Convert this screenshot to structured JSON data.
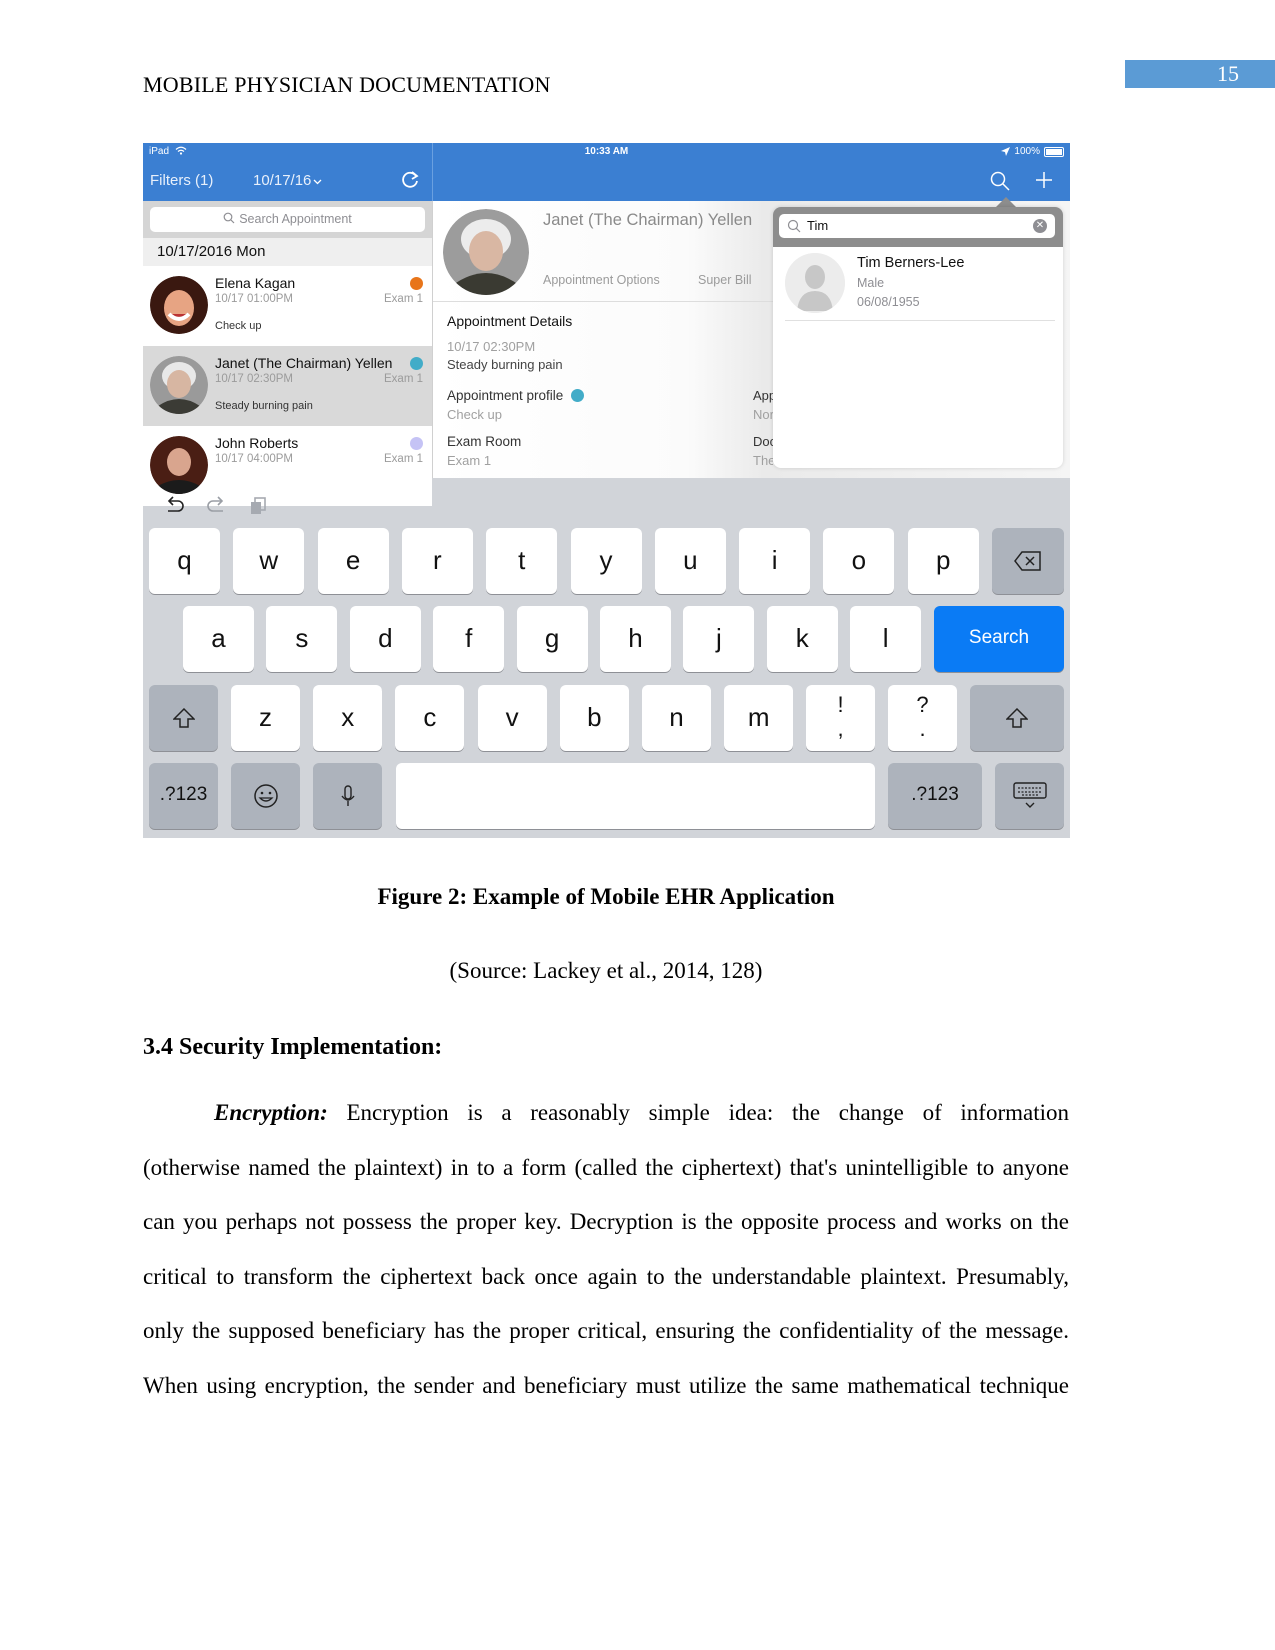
{
  "document": {
    "running_head": "MOBILE PHYSICIAN DOCUMENTATION",
    "page_number": "15",
    "figure_caption": "Figure 2: Example of Mobile EHR Application",
    "figure_source": "(Source: Lackey et al., 2014, 128)",
    "section_heading": "3.4 Security Implementation:",
    "paragraph": {
      "lead_term": "Encryption:",
      "lines": [
        "Encryption is a reasonably simple idea: the change of information",
        "(otherwise named the plaintext) in to a form (called the ciphertext) that's unintelligible to anyone",
        "can you perhaps not possess the proper key. Decryption is the opposite process and works on the",
        "critical to transform the ciphertext back once again to the understandable plaintext. Presumably,",
        "only the supposed beneficiary has the proper critical, ensuring the confidentiality of the message.",
        "When using encryption, the sender and beneficiary must utilize the same mathematical technique"
      ]
    }
  },
  "app": {
    "status_bar": {
      "device": "iPad",
      "time": "10:33 AM",
      "battery": "100%"
    },
    "nav": {
      "filters_label": "Filters (1)",
      "date_label": "10/17/16",
      "icons": [
        "wifi-icon",
        "refresh-icon",
        "search-icon",
        "plus-icon",
        "location-arrow-icon",
        "battery-icon"
      ]
    },
    "appointments": {
      "search_placeholder": "Search Appointment",
      "date_header": "10/17/2016 Mon",
      "items": [
        {
          "name": "Elena Kagan",
          "time": "10/17 01:00PM",
          "room": "Exam 1",
          "reason": "Check up",
          "status_color": "#e8751a",
          "selected": false
        },
        {
          "name": "Janet (The Chairman) Yellen",
          "time": "10/17 02:30PM",
          "room": "Exam 1",
          "reason": "Steady burning pain",
          "status_color": "#42acc8",
          "selected": true
        },
        {
          "name": "John Roberts",
          "time": "10/17 04:00PM",
          "room": "Exam 1",
          "reason": "",
          "status_color": "#c5c3f5",
          "selected": false
        }
      ]
    },
    "detail": {
      "patient_name": "Janet (The Chairman) Yellen",
      "tabs": [
        "Appointment Options",
        "Super Bill"
      ],
      "section_title": "Appointment Details",
      "datetime": "10/17 02:30PM",
      "complaint": "Steady burning pain",
      "profile_label": "Appointment profile",
      "profile_value": "Check up",
      "profile_color": "#42acc8",
      "room_label": "Exam Room",
      "room_value": "Exam 1",
      "clipped_right": [
        {
          "label": "App",
          "value": "Nor"
        },
        {
          "label": "Doc",
          "value": "The"
        }
      ]
    },
    "patient_search": {
      "query": "Tim",
      "results": [
        {
          "name": "Tim Berners-Lee",
          "gender": "Male",
          "dob": "06/08/1955"
        }
      ]
    },
    "keyboard": {
      "toolbar_icons": [
        "undo-icon",
        "redo-icon",
        "paste-icon"
      ],
      "row1": [
        "q",
        "w",
        "e",
        "r",
        "t",
        "y",
        "u",
        "i",
        "o",
        "p"
      ],
      "row2": [
        "a",
        "s",
        "d",
        "f",
        "g",
        "h",
        "j",
        "k",
        "l"
      ],
      "row3": [
        "z",
        "x",
        "c",
        "v",
        "b",
        "n",
        "m"
      ],
      "punct1": [
        "!",
        ","
      ],
      "punct2": [
        "?",
        "."
      ],
      "search_label": "Search",
      "numbers_label": ".?123",
      "accent_color": "#0a7bf5"
    }
  }
}
